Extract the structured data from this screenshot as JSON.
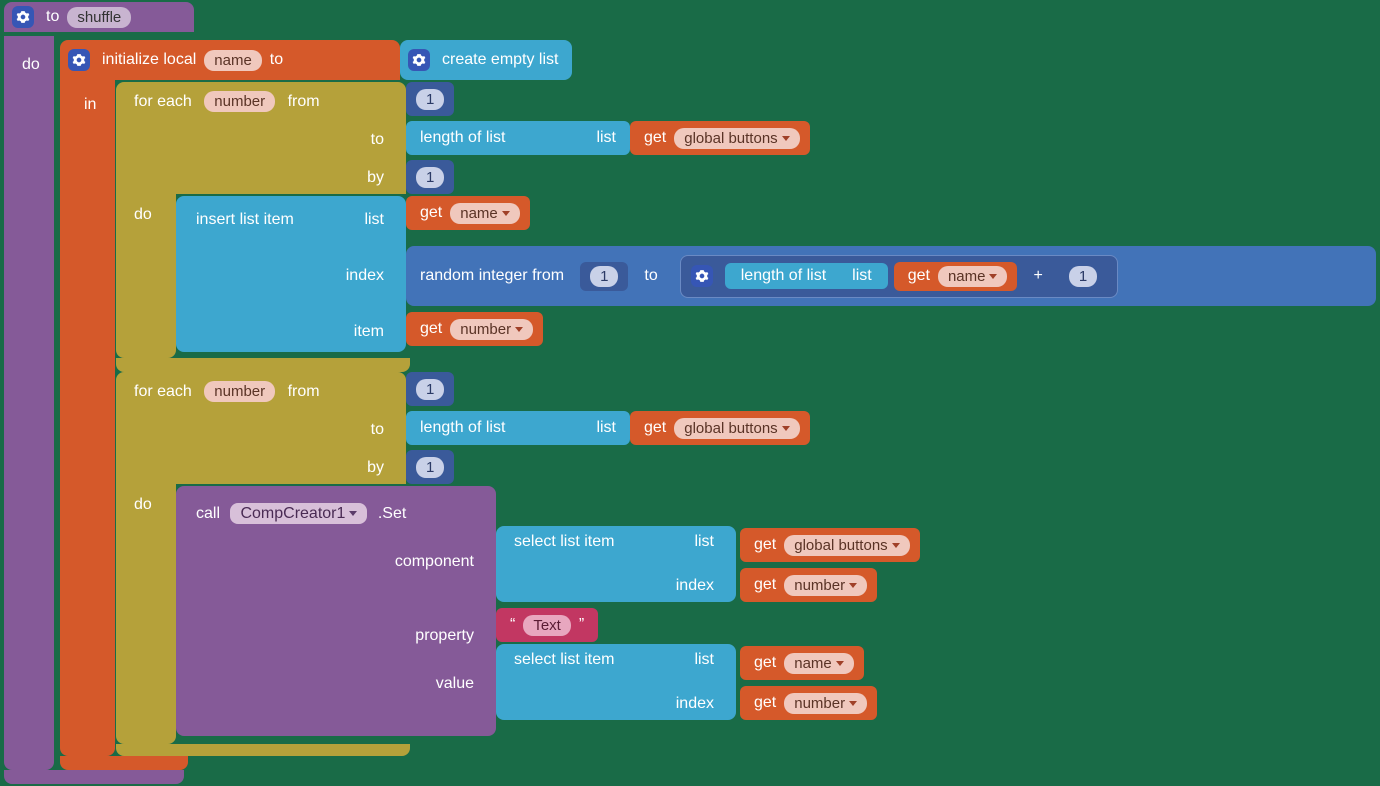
{
  "proc": {
    "to": "to",
    "do": "do",
    "name": "shuffle"
  },
  "init": {
    "label": "initialize local",
    "var": "name",
    "to": "to",
    "in": "in"
  },
  "createlist": "create empty list",
  "for": {
    "each": "for each",
    "var": "number",
    "from": "from",
    "to": "to",
    "by": "by",
    "do": "do"
  },
  "nums": {
    "one": "1"
  },
  "lenlist": "length of list",
  "list": "list",
  "get": "get",
  "vars": {
    "globalbuttons": "global buttons",
    "name": "name",
    "number": "number"
  },
  "insert": {
    "label": "insert list item",
    "list": "list",
    "index": "index",
    "item": "item"
  },
  "random": {
    "from": "random integer from",
    "to": "to",
    "plus": "+"
  },
  "call": {
    "call": "call",
    "obj": "CompCreator1",
    "method": ".Set",
    "component": "component",
    "property": "property",
    "value": "value"
  },
  "select": {
    "label": "select list item",
    "list": "list",
    "index": "index"
  },
  "text": {
    "q1": "“",
    "q2": "”",
    "val": "Text"
  }
}
